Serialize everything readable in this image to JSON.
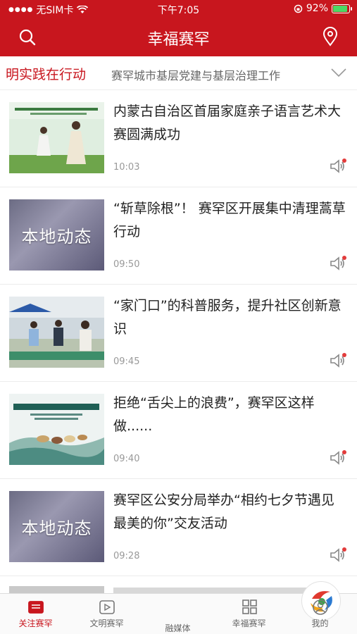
{
  "status": {
    "carrier": "无SIM卡",
    "time": "下午7:05",
    "battery": "92%",
    "battery_level": 0.92
  },
  "header": {
    "title": "幸福赛罕"
  },
  "ticker": {
    "hot": "明实践在行动",
    "topic": "赛罕城市基层党建与基层治理工作"
  },
  "news": [
    {
      "title": "内蒙古自治区首届家庭亲子语言艺术大赛圆满成功",
      "time": "10:03",
      "thumb": "photo-stage"
    },
    {
      "title": "“斩草除根”！ 赛罕区开展集中清理蒿草行动",
      "time": "09:50",
      "thumb": "本地动态"
    },
    {
      "title": "“家门口”的科普服务，提升社区创新意识",
      "time": "09:45",
      "thumb": "photo-outdoor"
    },
    {
      "title": "拒绝“舌尖上的浪费”，赛罕区这样做......",
      "time": "09:40",
      "thumb": "photo-poster"
    },
    {
      "title": "赛罕区公安分局举办“相约七夕节遇见最美的你”交友活动",
      "time": "09:28",
      "thumb": "本地动态"
    }
  ],
  "tabs": [
    {
      "label": "关注赛罕",
      "icon": "news-icon",
      "active": true
    },
    {
      "label": "文明赛罕",
      "icon": "play-icon",
      "active": false
    },
    {
      "label": "融媒体",
      "icon": "media-logo-icon",
      "active": false
    },
    {
      "label": "幸福赛罕",
      "icon": "grid-icon",
      "active": false
    },
    {
      "label": "我的",
      "icon": "user-icon",
      "active": false
    }
  ],
  "colors": {
    "brand": "#c8161e",
    "text": "#222222",
    "muted": "#999999",
    "badge": "#e23b3b"
  }
}
